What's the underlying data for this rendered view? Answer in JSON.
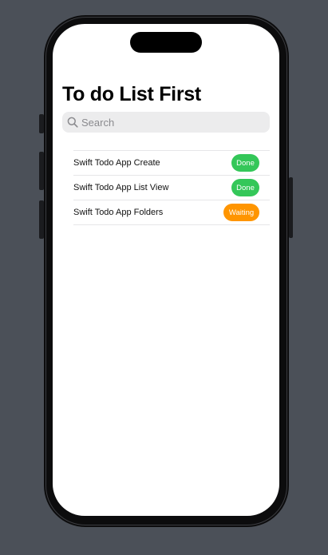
{
  "app": {
    "title": "To do List First"
  },
  "search": {
    "placeholder": "Search",
    "value": ""
  },
  "colors": {
    "done": "#34c759",
    "waiting": "#ff9500"
  },
  "todos": [
    {
      "title": "Swift Todo App Create",
      "status": "Done"
    },
    {
      "title": "Swift Todo App List View",
      "status": "Done"
    },
    {
      "title": "Swift Todo App Folders",
      "status": "Waiting"
    }
  ]
}
